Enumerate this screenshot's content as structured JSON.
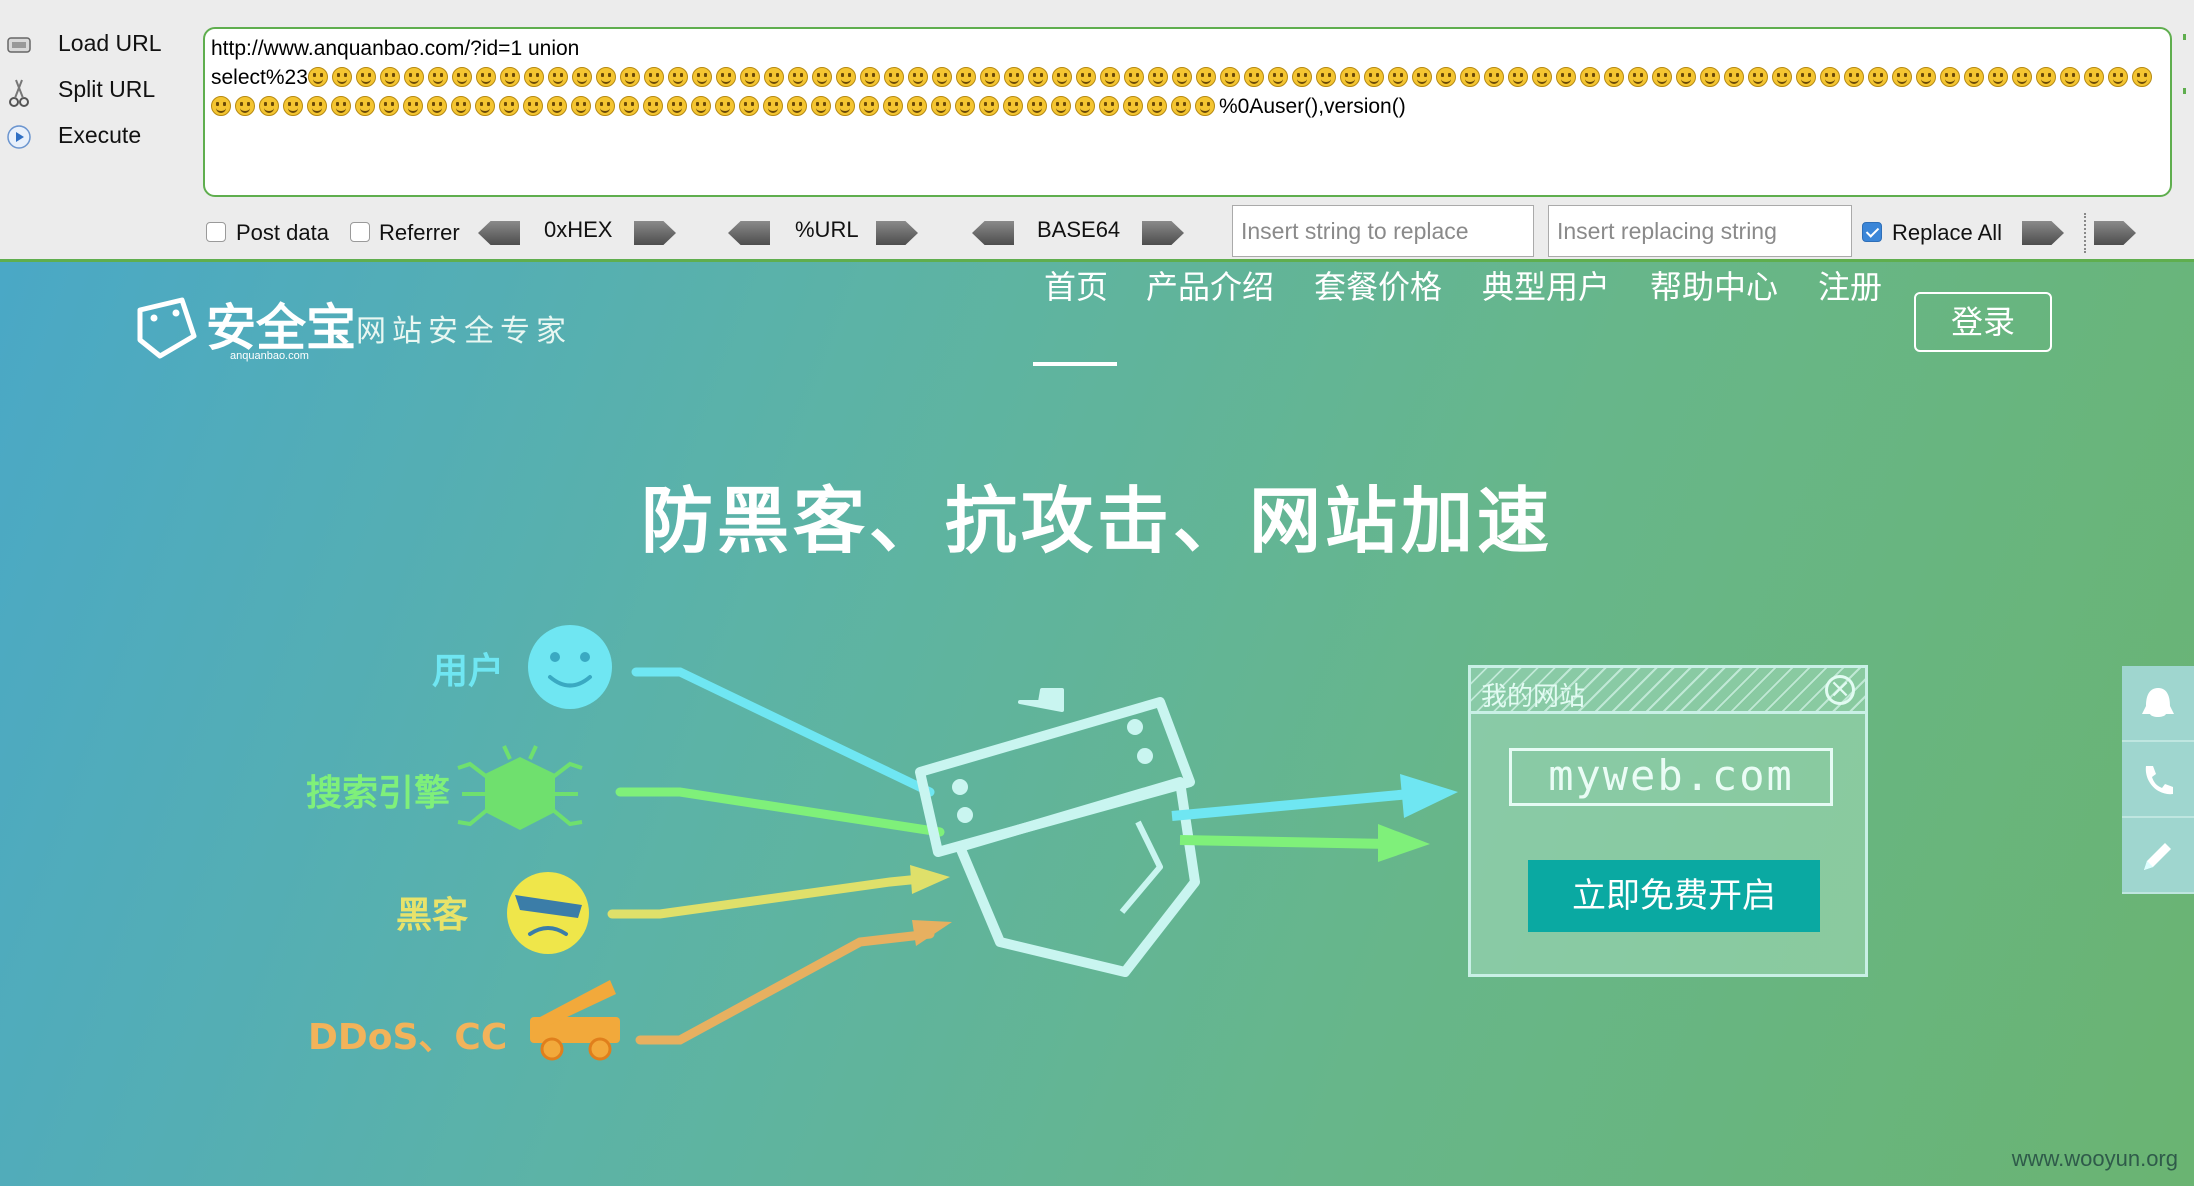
{
  "hackbar": {
    "side_buttons": [
      {
        "label": "Load URL",
        "icon": "load-url-icon"
      },
      {
        "label": "Split URL",
        "icon": "scissors-icon"
      },
      {
        "label": "Execute",
        "icon": "play-icon"
      }
    ],
    "url_line1": "http://www.anquanbao.com/?id=1 union",
    "url_prefix": "select%23",
    "url_smiley_count": 119,
    "url_suffix": "%0Auser(),version()",
    "options": {
      "post_data": {
        "label": "Post data",
        "checked": false
      },
      "referrer": {
        "label": "Referrer",
        "checked": false
      },
      "encoders": [
        "0xHEX",
        "%URL",
        "BASE64"
      ],
      "replace_from_placeholder": "Insert string to replace",
      "replace_to_placeholder": "Insert replacing string",
      "replace_all": {
        "label": "Replace All",
        "checked": true
      }
    },
    "accent_color": "#5fae4e"
  },
  "site": {
    "logo_text": "安全宝",
    "logo_sub": "anquanbao.com",
    "slogan": "网站安全专家",
    "nav": [
      "首页",
      "产品介绍",
      "套餐价格",
      "典型用户",
      "帮助中心",
      "注册"
    ],
    "active_nav": "首页",
    "login_label": "登录",
    "hero_title": "防黑客、抗攻击、网站加速",
    "sources": [
      {
        "label": "用户",
        "color": "#6fe6f2",
        "icon": "smiley-face-icon"
      },
      {
        "label": "搜索引擎",
        "color": "#7ff07a",
        "icon": "bug-spider-icon"
      },
      {
        "label": "黑客",
        "color": "#e8e36a",
        "icon": "angry-face-icon"
      },
      {
        "label": "DDoS、CC",
        "color": "#f2b35a",
        "icon": "cannon-truck-icon"
      }
    ],
    "window_title": "我的网站",
    "window_url": "myweb.com",
    "window_button": "立即免费开启",
    "side_tools": [
      "qq-penguin-icon",
      "phone-icon",
      "pencil-icon"
    ],
    "watermark": "www.wooyun.org"
  }
}
